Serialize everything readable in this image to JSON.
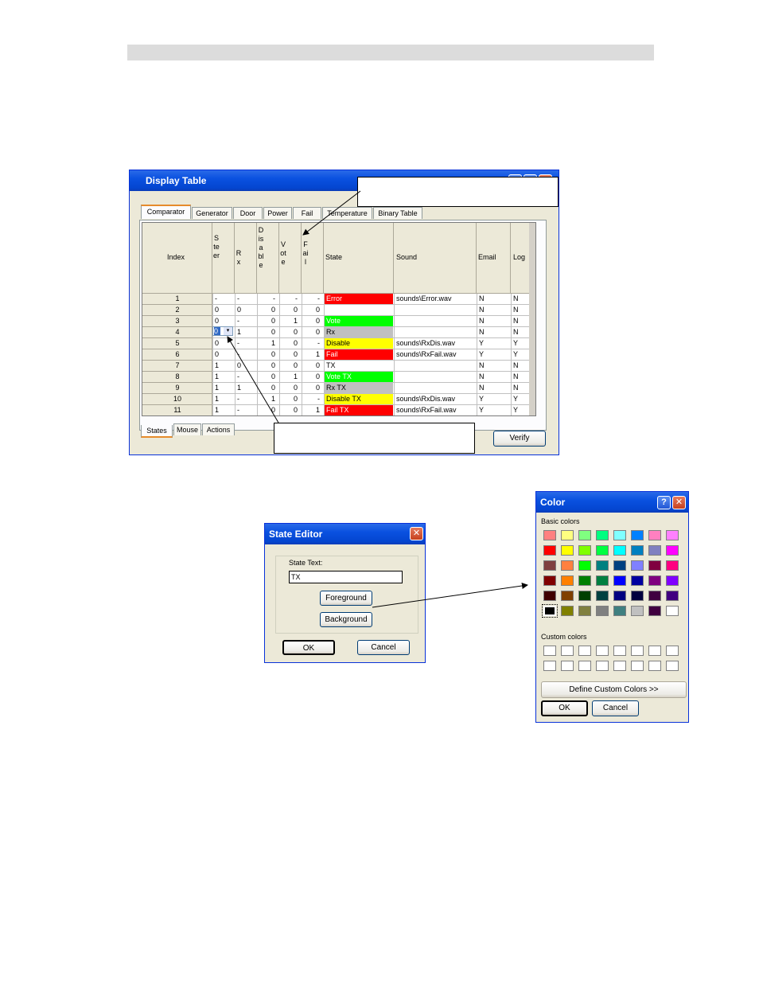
{
  "display_table": {
    "title": "Display Table",
    "top_tabs": [
      "Comparator",
      "Generator",
      "Door",
      "Power",
      "Fail",
      "Temperature",
      "Binary Table"
    ],
    "columns": [
      "Index",
      "Steer",
      "Rx",
      "Disable",
      "Vote",
      "Fail",
      "State",
      "Sound",
      "Email",
      "Log"
    ],
    "rows": [
      {
        "index": "1",
        "steer": "-",
        "rx": "-",
        "disable": "-",
        "vote": "-",
        "fail": "-",
        "state": "Error",
        "state_bg": "#ff0000",
        "state_fg": "#ffffff",
        "sound": "sounds\\Error.wav",
        "email": "N",
        "log": "N"
      },
      {
        "index": "2",
        "steer": "0",
        "rx": "0",
        "disable": "0",
        "vote": "0",
        "fail": "0",
        "state": "",
        "state_bg": "#ffffff",
        "state_fg": "#000000",
        "sound": "",
        "email": "N",
        "log": "N"
      },
      {
        "index": "3",
        "steer": "0",
        "rx": "-",
        "disable": "0",
        "vote": "1",
        "fail": "0",
        "state": "Vote",
        "state_bg": "#00ff00",
        "state_fg": "#ffffff",
        "sound": "",
        "email": "N",
        "log": "N"
      },
      {
        "index": "4",
        "steer": "0",
        "rx": "1",
        "disable": "0",
        "vote": "0",
        "fail": "0",
        "state": "Rx",
        "state_bg": "#c0c0c0",
        "state_fg": "#000000",
        "sound": "",
        "email": "N",
        "log": "N"
      },
      {
        "index": "5",
        "steer": "0",
        "rx": "-",
        "disable": "1",
        "vote": "0",
        "fail": "-",
        "state": "Disable",
        "state_bg": "#ffff00",
        "state_fg": "#000000",
        "sound": "sounds\\RxDis.wav",
        "email": "Y",
        "log": "Y"
      },
      {
        "index": "6",
        "steer": "0",
        "rx": "-",
        "disable": "0",
        "vote": "0",
        "fail": "1",
        "state": "Fail",
        "state_bg": "#ff0000",
        "state_fg": "#ffffff",
        "sound": "sounds\\RxFail.wav",
        "email": "Y",
        "log": "Y"
      },
      {
        "index": "7",
        "steer": "1",
        "rx": "0",
        "disable": "0",
        "vote": "0",
        "fail": "0",
        "state": "TX",
        "state_bg": "#ffffff",
        "state_fg": "#000000",
        "sound": "",
        "email": "N",
        "log": "N"
      },
      {
        "index": "8",
        "steer": "1",
        "rx": "-",
        "disable": "0",
        "vote": "1",
        "fail": "0",
        "state": "Vote TX",
        "state_bg": "#00ff00",
        "state_fg": "#ffffff",
        "sound": "",
        "email": "N",
        "log": "N"
      },
      {
        "index": "9",
        "steer": "1",
        "rx": "1",
        "disable": "0",
        "vote": "0",
        "fail": "0",
        "state": "Rx TX",
        "state_bg": "#c0c0c0",
        "state_fg": "#000000",
        "sound": "",
        "email": "N",
        "log": "N"
      },
      {
        "index": "10",
        "steer": "1",
        "rx": "-",
        "disable": "1",
        "vote": "0",
        "fail": "-",
        "state": "Disable TX",
        "state_bg": "#ffff00",
        "state_fg": "#000000",
        "sound": "sounds\\RxDis.wav",
        "email": "Y",
        "log": "Y"
      },
      {
        "index": "11",
        "steer": "1",
        "rx": "-",
        "disable": "0",
        "vote": "0",
        "fail": "1",
        "state": "Fail TX",
        "state_bg": "#ff0000",
        "state_fg": "#ffffff",
        "sound": "sounds\\RxFail.wav",
        "email": "Y",
        "log": "Y"
      }
    ],
    "bottom_tabs": [
      "States",
      "Mouse",
      "Actions"
    ],
    "verify_label": "Verify"
  },
  "state_editor": {
    "title": "State Editor",
    "state_text_label": "State Text:",
    "state_text_value": "TX",
    "foreground_label": "Foreground",
    "background_label": "Background",
    "ok_label": "OK",
    "cancel_label": "Cancel"
  },
  "color_dialog": {
    "title": "Color",
    "basic_colors_label": "Basic colors",
    "basic_colors": [
      "#ff8080",
      "#ffff80",
      "#80ff80",
      "#00ff80",
      "#80ffff",
      "#0080ff",
      "#ff80c0",
      "#ff80ff",
      "#ff0000",
      "#ffff00",
      "#80ff00",
      "#00ff40",
      "#00ffff",
      "#0080c0",
      "#8080c0",
      "#ff00ff",
      "#804040",
      "#ff8040",
      "#00ff00",
      "#008080",
      "#004080",
      "#8080ff",
      "#800040",
      "#ff0080",
      "#800000",
      "#ff8000",
      "#008000",
      "#008040",
      "#0000ff",
      "#0000a0",
      "#800080",
      "#8000ff",
      "#400000",
      "#804000",
      "#004000",
      "#004040",
      "#000080",
      "#000040",
      "#400040",
      "#400080",
      "#000000",
      "#808000",
      "#808040",
      "#808080",
      "#408080",
      "#c0c0c0",
      "#400040",
      "#ffffff"
    ],
    "custom_colors_label": "Custom colors",
    "define_custom_label": "Define Custom Colors >>",
    "ok_label": "OK",
    "cancel_label": "Cancel"
  }
}
